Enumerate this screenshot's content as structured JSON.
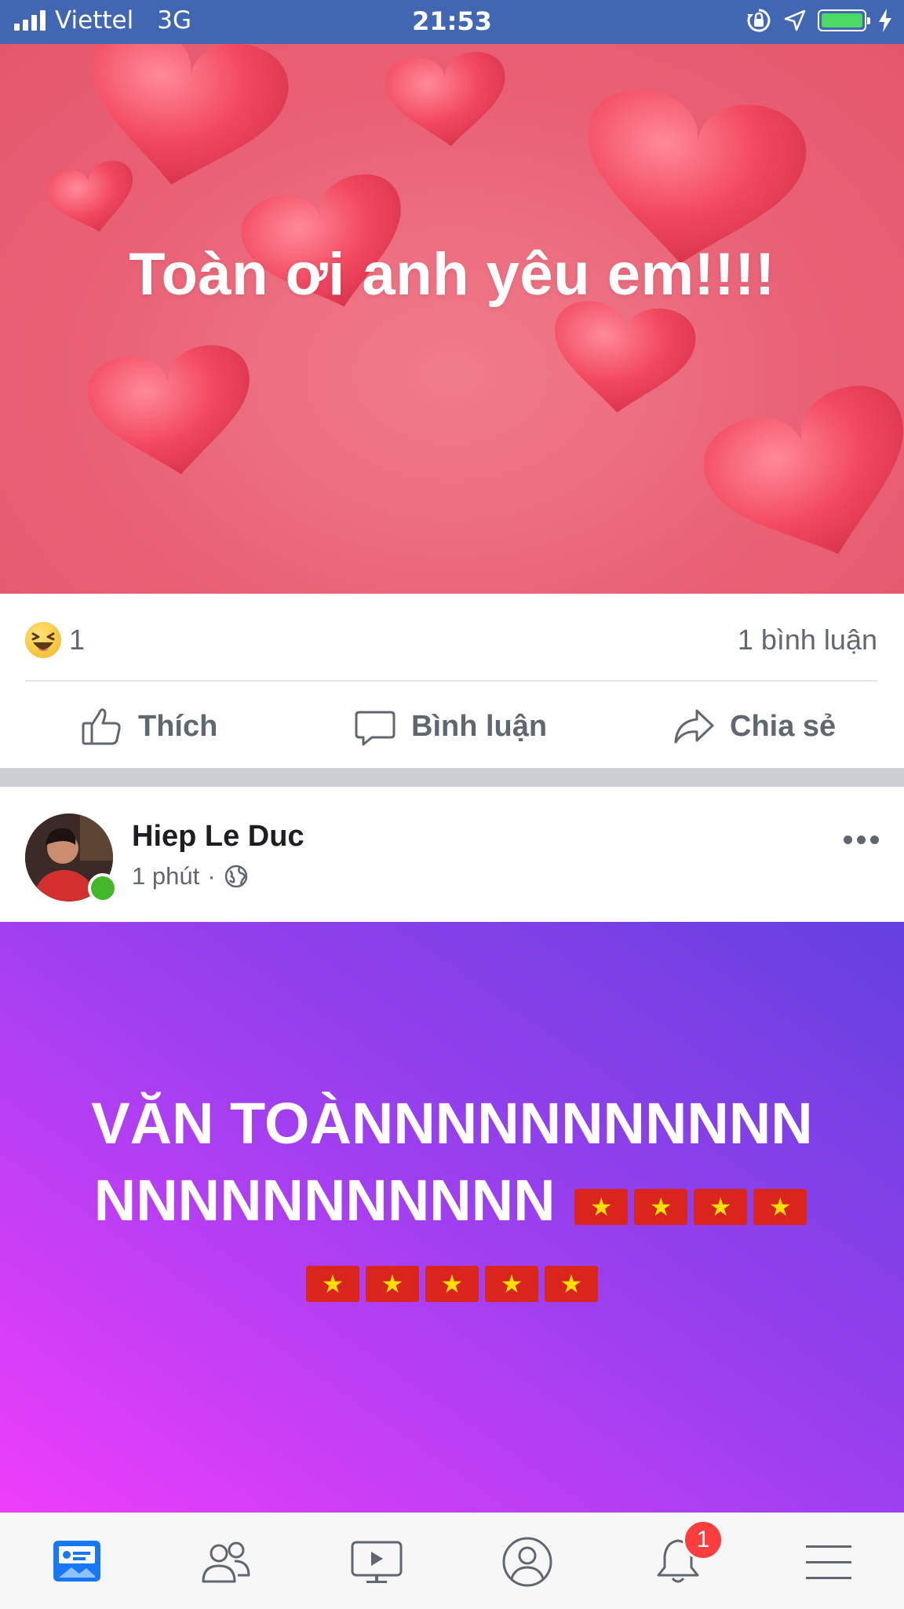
{
  "status_bar": {
    "carrier": "Viettel",
    "network": "3G",
    "time": "21:53",
    "icons": [
      "signal-icon",
      "orientation-lock-icon",
      "location-icon",
      "battery-icon",
      "charging-icon"
    ],
    "battery_level": 1.0
  },
  "post1": {
    "background_text": "Toàn ơi anh yêu em!!!!",
    "reaction_emoji": "haha",
    "reaction_count": "1",
    "comment_count": "1 bình luận"
  },
  "actions": {
    "like": "Thích",
    "comment": "Bình luận",
    "share": "Chia sẻ"
  },
  "post2": {
    "author": "Hiep Le Duc",
    "time": "1 phút",
    "separator": "·",
    "privacy_icon": "globe-icon",
    "text": "VĂN TOÀNNNNNNNNNNNNNNNNNNNNNN",
    "flag_count": 9
  },
  "tab_bar": {
    "items": [
      "news-feed-icon",
      "friends-icon",
      "watch-icon",
      "profile-icon",
      "notifications-icon",
      "menu-icon"
    ],
    "notification_badge": "1"
  },
  "colors": {
    "brand": "#4267b2",
    "active_tab": "#1877f2",
    "inactive_tab": "#606770",
    "badge": "#fa3e3e",
    "online": "#42b72a",
    "post1_bg": "#ea6277",
    "post2_gradient_start": "#6440de",
    "post2_gradient_end": "#ee3dfb"
  }
}
